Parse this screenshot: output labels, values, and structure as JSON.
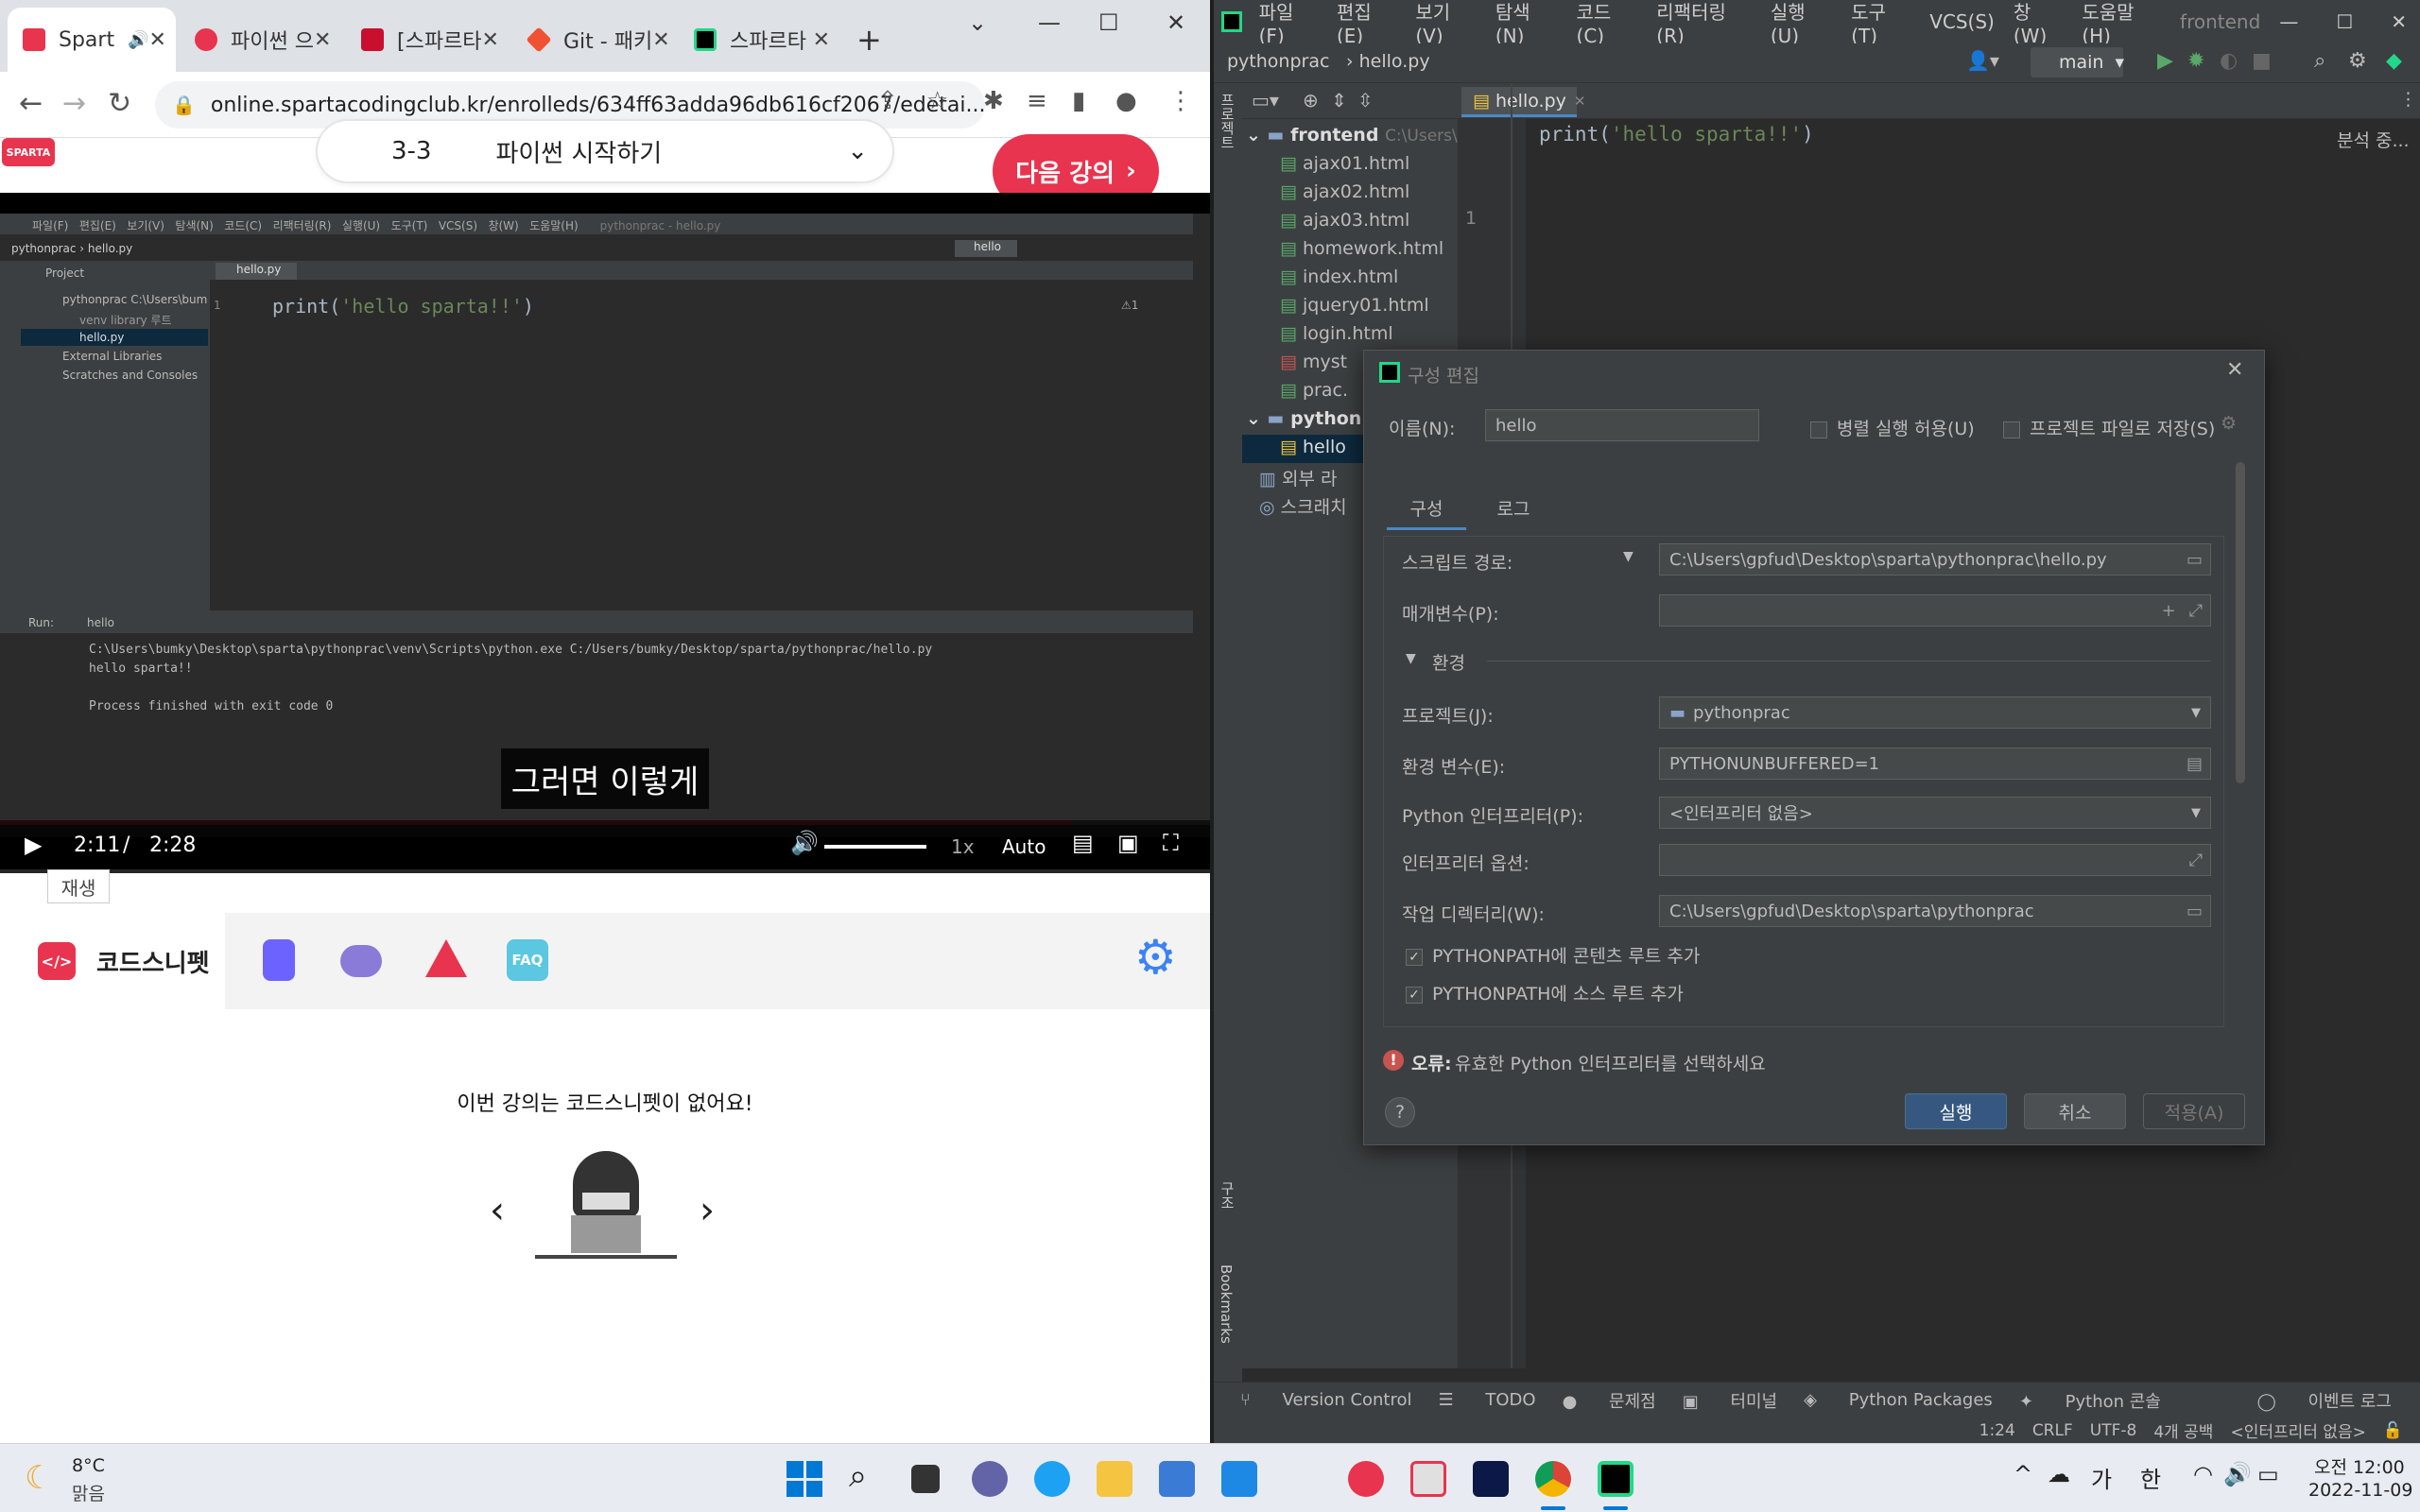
{
  "chrome": {
    "tabs": [
      {
        "title": "Spart",
        "color": "#e8344e"
      },
      {
        "title": "파이썬 으",
        "color": "#e8344e"
      },
      {
        "title": "[스파르타",
        "color": "#c8102e"
      },
      {
        "title": "Git - 패키",
        "color": "#f05133"
      },
      {
        "title": "스파르타",
        "color": "#21d789"
      }
    ],
    "new_tab_label": "+",
    "url": "online.spartacodingclub.kr/enrolleds/634ff63adda96db616cf2067/edetai..."
  },
  "lecture": {
    "logo_text": "SPARTA",
    "number": "3-3",
    "title": "파이썬 시작하기",
    "next_button": "다음 강의"
  },
  "video": {
    "ide": {
      "menu": [
        "파일(F)",
        "편집(E)",
        "보기(V)",
        "탐색(N)",
        "코드(C)",
        "리팩터링(R)",
        "실행(U)",
        "도구(T)",
        "VCS(S)",
        "창(W)",
        "도움말(H)"
      ],
      "title": "pythonprac - hello.py",
      "breadcrumb_project": "pythonprac",
      "breadcrumb_file": "hello.py",
      "run_config": "hello",
      "project_label": "Project",
      "tree": [
        "pythonprac  C:\\Users\\bum",
        "venv  library 루트",
        "hello.py",
        "External Libraries",
        "Scratches and Consoles"
      ],
      "tab": "hello.py",
      "line_no": "1",
      "code_fn": "print(",
      "code_str": "'hello sparta!!'",
      "code_end": ")",
      "warn": "⚠1",
      "run_label": "Run:",
      "run_tab": "hello",
      "run_lines": [
        "C:\\Users\\bumky\\Desktop\\sparta\\pythonprac\\venv\\Scripts\\python.exe C:/Users/bumky/Desktop/sparta/pythonprac/hello.py",
        "hello sparta!!",
        "",
        "Process finished with exit code 0"
      ]
    },
    "subtitle": "그러면 이렇게",
    "current_time": "2:11",
    "separator": "/",
    "duration": "2:28",
    "progress": 0.886,
    "speed": "1x",
    "quality": "Auto",
    "play_tooltip": "재생"
  },
  "snippet": {
    "tab_label": "코드스니펫",
    "faq_label": "FAQ",
    "empty_message": "이번 강의는 코드스니펫이 없어요!"
  },
  "pycharm": {
    "menu": [
      "파일(F)",
      "편집(E)",
      "보기(V)",
      "탐색(N)",
      "코드(C)",
      "리팩터링(R)",
      "실행(U)",
      "도구(T)",
      "VCS(S)",
      "창(W)",
      "도움말(H)",
      "frontend"
    ],
    "breadcrumb_project": "pythonprac",
    "breadcrumb_file": "hello.py",
    "branch": "main",
    "side_label": "프로젝트",
    "tree": [
      {
        "label": "frontend",
        "suffix": "C:\\Users\\",
        "level": 0,
        "type": "folder"
      },
      {
        "label": "ajax01.html",
        "level": 1,
        "type": "html"
      },
      {
        "label": "ajax02.html",
        "level": 1,
        "type": "html"
      },
      {
        "label": "ajax03.html",
        "level": 1,
        "type": "html"
      },
      {
        "label": "homework.html",
        "level": 1,
        "type": "html"
      },
      {
        "label": "index.html",
        "level": 1,
        "type": "html"
      },
      {
        "label": "jquery01.html",
        "level": 1,
        "type": "html"
      },
      {
        "label": "login.html",
        "level": 1,
        "type": "html"
      },
      {
        "label": "myst",
        "level": 1,
        "type": "css"
      },
      {
        "label": "prac.",
        "level": 1,
        "type": "html"
      },
      {
        "label": "python",
        "level": 0,
        "type": "folder"
      },
      {
        "label": "hello",
        "level": 1,
        "type": "py"
      },
      {
        "label": "외부 라",
        "level": 0,
        "type": "lib"
      },
      {
        "label": "스크래치",
        "level": 0,
        "type": "scratch"
      }
    ],
    "editor_tab": "hello.py",
    "line_no": "1",
    "code_fn": "print(",
    "code_str": "'hello sparta!!'",
    "code_end": ")",
    "analysis": "분석 중...",
    "structure_label": "구조",
    "bookmarks_label": "Bookmarks",
    "bottom_tabs": [
      "Version Control",
      "TODO",
      "문제점",
      "터미널",
      "Python Packages",
      "Python 콘솔"
    ],
    "event_log": "이벤트 로그",
    "status": [
      "1:24",
      "CRLF",
      "UTF-8",
      "4개 공백",
      "<인터프리터 없음>"
    ]
  },
  "dialog": {
    "title": "구성 편집",
    "name_label": "이름(N):",
    "name_value": "hello",
    "parallel_label": "병렬 실행 허용(U)",
    "save_label": "프로젝트 파일로 저장(S)",
    "tabs": [
      "구성",
      "로그"
    ],
    "script_label": "스크립트 경로:",
    "script_value": "C:\\Users\\gpfud\\Desktop\\sparta\\pythonprac\\hello.py",
    "params_label": "매개변수(P):",
    "params_value": "",
    "env_section": "환경",
    "project_label": "프로젝트(J):",
    "project_value": "pythonprac",
    "env_label": "환경 변수(E):",
    "env_value": "PYTHONUNBUFFERED=1",
    "interp_label": "Python 인터프리터(P):",
    "interp_value": "<인터프리터 없음>",
    "interp_opts_label": "인터프리터 옵션:",
    "interp_opts_value": "",
    "workdir_label": "작업 디렉터리(W):",
    "workdir_value": "C:\\Users\\gpfud\\Desktop\\sparta\\pythonprac",
    "chk_content": "PYTHONPATH에 콘텐츠 루트 추가",
    "chk_source": "PYTHONPATH에 소스 루트 추가",
    "error_prefix": "오류:",
    "error_text": "유효한 Python 인터프리터를 선택하세요",
    "run_button": "실행",
    "cancel_button": "취소",
    "apply_button": "적용(A)"
  },
  "taskbar": {
    "weather_temp": "8°C",
    "weather_desc": "맑음",
    "ime_1": "가",
    "ime_2": "한",
    "time": "오전 12:00",
    "date": "2022-11-09"
  }
}
